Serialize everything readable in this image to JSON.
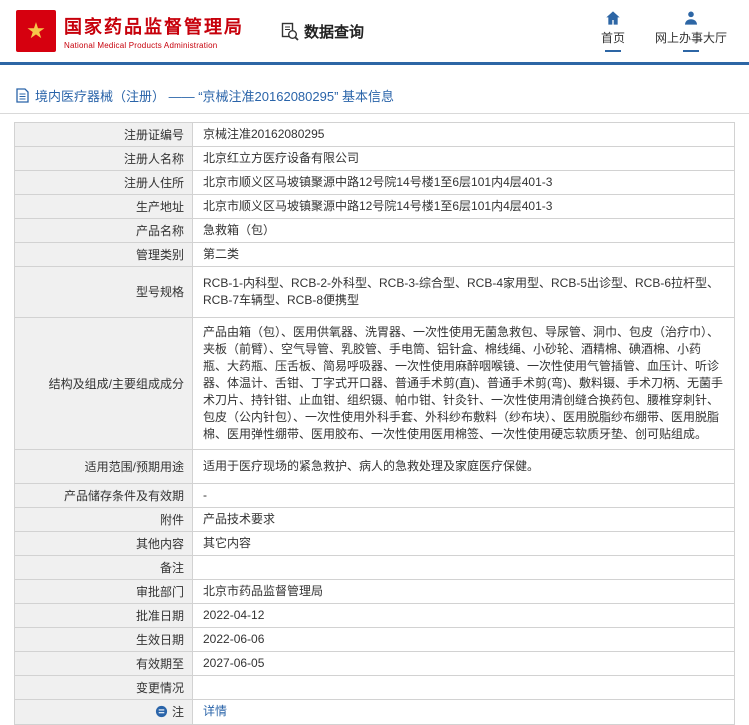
{
  "header": {
    "title_cn": "国家药品监督管理局",
    "title_en": "National Medical Products Administration",
    "data_query_label": "数据查询",
    "nav_home": "首页",
    "nav_hall": "网上办事大厅"
  },
  "breadcrumb": {
    "title": "境内医疗器械（注册） —— “京械注准20162080295” 基本信息"
  },
  "colors": {
    "brand_red": "#c7000b",
    "accent_blue": "#2d66a5",
    "link_blue": "#2a64a9",
    "label_bg": "#f0f0f0"
  },
  "table": {
    "rows": [
      {
        "label": "注册证编号",
        "value": "京械注准20162080295"
      },
      {
        "label": "注册人名称",
        "value": "北京红立方医疗设备有限公司"
      },
      {
        "label": "注册人住所",
        "value": "北京市顺义区马坡镇聚源中路12号院14号楼1至6层101内4层401-3"
      },
      {
        "label": "生产地址",
        "value": "北京市顺义区马坡镇聚源中路12号院14号楼1至6层101内4层401-3"
      },
      {
        "label": "产品名称",
        "value": "急救箱（包）"
      },
      {
        "label": "管理类别",
        "value": "第二类"
      },
      {
        "label": "型号规格",
        "value": "RCB-1-内科型、RCB-2-外科型、RCB-3-综合型、RCB-4家用型、RCB-5出诊型、RCB-6拉杆型、RCB-7车辆型、RCB-8便携型"
      },
      {
        "label": "结构及组成/主要组成成分",
        "value": "产品由箱（包）、医用供氧器、洗胃器、一次性使用无菌急救包、导尿管、洞巾、包皮（治疗巾）、夹板（前臂）、空气导管、乳胶管、手电筒、铝针盒、棉线绳、小砂轮、酒精棉、碘酒棉、小药瓶、大药瓶、压舌板、简易呼吸器、一次性使用麻醉咽喉镜、一次性使用气管插管、血压计、听诊器、体温计、舌钳、丁字式开口器、普通手术剪(直)、普通手术剪(弯)、敷料镊、手术刀柄、无菌手术刀片、持针钳、止血钳、组织镊、帕巾钳、针灸针、一次性使用清创缝合换药包、腰椎穿刺针、包皮（公内针包）、一次性使用外科手套、外科纱布敷料（纱布块）、医用脱脂纱布绷带、医用脱脂棉、医用弹性绷带、医用胶布、一次性使用医用棉签、一次性使用硬忘软质牙垫、创可贴组成。"
      },
      {
        "label": "适用范围/预期用途",
        "value": "适用于医疗现场的紧急救护、病人的急救处理及家庭医疗保健。"
      },
      {
        "label": "产品储存条件及有效期",
        "value": "-"
      },
      {
        "label": "附件",
        "value": "产品技术要求"
      },
      {
        "label": "其他内容",
        "value": "其它内容"
      },
      {
        "label": "备注",
        "value": ""
      },
      {
        "label": "审批部门",
        "value": "北京市药品监督管理局"
      },
      {
        "label": "批准日期",
        "value": "2022-04-12"
      },
      {
        "label": "生效日期",
        "value": "2022-06-06"
      },
      {
        "label": "有效期至",
        "value": "2027-06-05"
      },
      {
        "label": "变更情况",
        "value": ""
      },
      {
        "label": "注",
        "value": "详情"
      }
    ]
  }
}
